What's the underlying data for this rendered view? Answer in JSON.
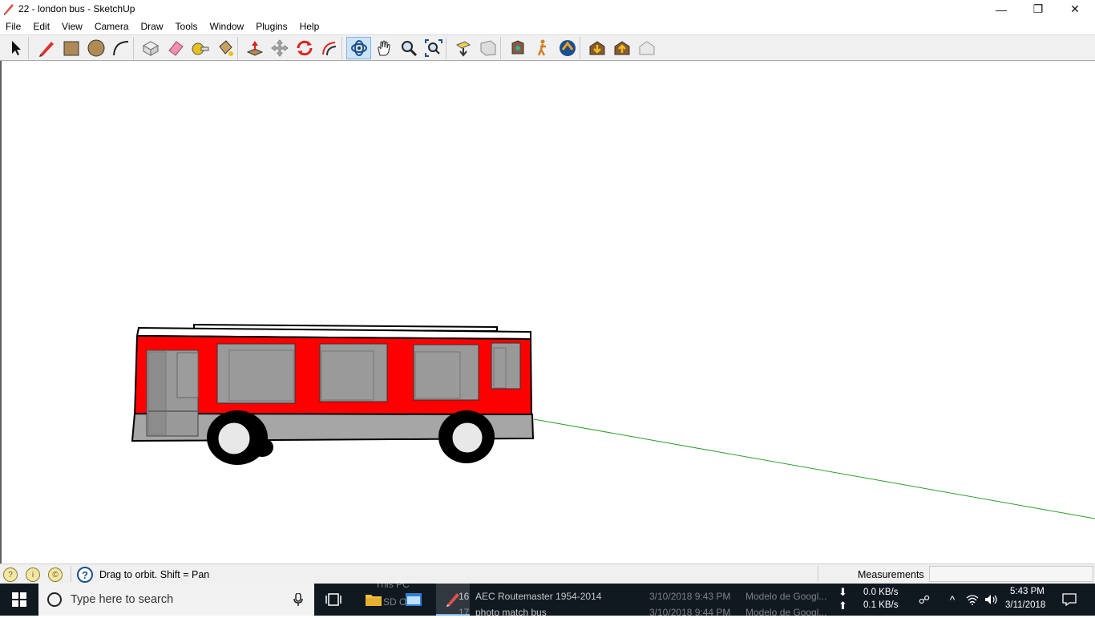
{
  "window": {
    "title": "22 - london bus - SketchUp",
    "minimize_glyph": "—",
    "maximize_glyph": "❐",
    "close_glyph": "✕"
  },
  "menu": [
    "File",
    "Edit",
    "View",
    "Camera",
    "Draw",
    "Tools",
    "Window",
    "Plugins",
    "Help"
  ],
  "toolbar": {
    "groups": [
      [
        "select-icon"
      ],
      [
        "pencil-line-icon",
        "rectangle-icon",
        "circle-icon",
        "arc-icon"
      ],
      [
        "make-component-icon",
        "eraser-icon",
        "tape-measure-icon",
        "paint-bucket-icon"
      ],
      [
        "push-pull-icon",
        "move-icon",
        "rotate-icon",
        "offset-icon"
      ],
      [
        "orbit-icon",
        "pan-icon",
        "zoom-icon",
        "zoom-extents-icon"
      ],
      [
        "previous-view-icon",
        "next-view-icon"
      ],
      [
        "position-camera-icon",
        "walk-icon",
        "look-around-icon"
      ],
      [
        "get-models-icon",
        "share-model-icon",
        "share-component-icon"
      ]
    ],
    "active_tool": "orbit-icon"
  },
  "colors": {
    "bus_red": "#ff0000",
    "bus_gray": "#a6a6a6",
    "window_gray": "#999999",
    "green_axis": "#2ca02c",
    "taskbar": "#101820"
  },
  "status": {
    "message": "Drag to orbit.  Shift = Pan",
    "measurements_label": "Measurements",
    "measurements_value": ""
  },
  "taskbar": {
    "search_placeholder": "Type here to search",
    "ghost_rows": [
      {
        "num": "This PC",
        "name": "",
        "date": "",
        "type": ""
      },
      {
        "num": "16",
        "name": "AEC Routemaster 1954-2014",
        "date": "3/10/2018 9:43 PM",
        "type": "Modelo de Googl..."
      },
      {
        "num": "SD OS",
        "name": "",
        "date": "",
        "type": ""
      },
      {
        "num": "17",
        "name": "photo match bus",
        "date": "3/10/2018 9:44 PM",
        "type": "Modelo de Googl..."
      }
    ],
    "net_down": "0.0 KB/s",
    "net_up": "0.1 KB/s",
    "time": "5:43 PM",
    "date": "3/11/2018"
  }
}
